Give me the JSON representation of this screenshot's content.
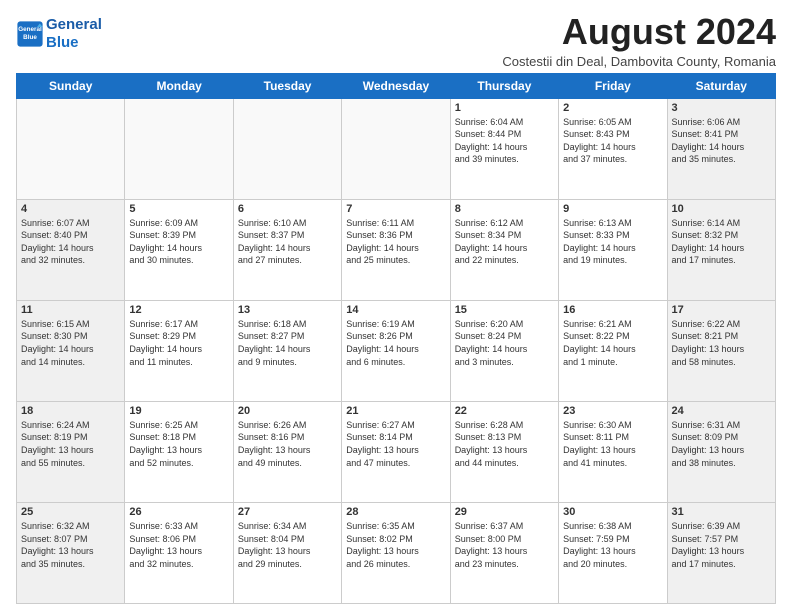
{
  "logo": {
    "line1": "General",
    "line2": "Blue"
  },
  "title": "August 2024",
  "subtitle": "Costestii din Deal, Dambovita County, Romania",
  "days_header": [
    "Sunday",
    "Monday",
    "Tuesday",
    "Wednesday",
    "Thursday",
    "Friday",
    "Saturday"
  ],
  "weeks": [
    [
      {
        "day": "",
        "info": ""
      },
      {
        "day": "",
        "info": ""
      },
      {
        "day": "",
        "info": ""
      },
      {
        "day": "",
        "info": ""
      },
      {
        "day": "1",
        "info": "Sunrise: 6:04 AM\nSunset: 8:44 PM\nDaylight: 14 hours\nand 39 minutes."
      },
      {
        "day": "2",
        "info": "Sunrise: 6:05 AM\nSunset: 8:43 PM\nDaylight: 14 hours\nand 37 minutes."
      },
      {
        "day": "3",
        "info": "Sunrise: 6:06 AM\nSunset: 8:41 PM\nDaylight: 14 hours\nand 35 minutes."
      }
    ],
    [
      {
        "day": "4",
        "info": "Sunrise: 6:07 AM\nSunset: 8:40 PM\nDaylight: 14 hours\nand 32 minutes."
      },
      {
        "day": "5",
        "info": "Sunrise: 6:09 AM\nSunset: 8:39 PM\nDaylight: 14 hours\nand 30 minutes."
      },
      {
        "day": "6",
        "info": "Sunrise: 6:10 AM\nSunset: 8:37 PM\nDaylight: 14 hours\nand 27 minutes."
      },
      {
        "day": "7",
        "info": "Sunrise: 6:11 AM\nSunset: 8:36 PM\nDaylight: 14 hours\nand 25 minutes."
      },
      {
        "day": "8",
        "info": "Sunrise: 6:12 AM\nSunset: 8:34 PM\nDaylight: 14 hours\nand 22 minutes."
      },
      {
        "day": "9",
        "info": "Sunrise: 6:13 AM\nSunset: 8:33 PM\nDaylight: 14 hours\nand 19 minutes."
      },
      {
        "day": "10",
        "info": "Sunrise: 6:14 AM\nSunset: 8:32 PM\nDaylight: 14 hours\nand 17 minutes."
      }
    ],
    [
      {
        "day": "11",
        "info": "Sunrise: 6:15 AM\nSunset: 8:30 PM\nDaylight: 14 hours\nand 14 minutes."
      },
      {
        "day": "12",
        "info": "Sunrise: 6:17 AM\nSunset: 8:29 PM\nDaylight: 14 hours\nand 11 minutes."
      },
      {
        "day": "13",
        "info": "Sunrise: 6:18 AM\nSunset: 8:27 PM\nDaylight: 14 hours\nand 9 minutes."
      },
      {
        "day": "14",
        "info": "Sunrise: 6:19 AM\nSunset: 8:26 PM\nDaylight: 14 hours\nand 6 minutes."
      },
      {
        "day": "15",
        "info": "Sunrise: 6:20 AM\nSunset: 8:24 PM\nDaylight: 14 hours\nand 3 minutes."
      },
      {
        "day": "16",
        "info": "Sunrise: 6:21 AM\nSunset: 8:22 PM\nDaylight: 14 hours\nand 1 minute."
      },
      {
        "day": "17",
        "info": "Sunrise: 6:22 AM\nSunset: 8:21 PM\nDaylight: 13 hours\nand 58 minutes."
      }
    ],
    [
      {
        "day": "18",
        "info": "Sunrise: 6:24 AM\nSunset: 8:19 PM\nDaylight: 13 hours\nand 55 minutes."
      },
      {
        "day": "19",
        "info": "Sunrise: 6:25 AM\nSunset: 8:18 PM\nDaylight: 13 hours\nand 52 minutes."
      },
      {
        "day": "20",
        "info": "Sunrise: 6:26 AM\nSunset: 8:16 PM\nDaylight: 13 hours\nand 49 minutes."
      },
      {
        "day": "21",
        "info": "Sunrise: 6:27 AM\nSunset: 8:14 PM\nDaylight: 13 hours\nand 47 minutes."
      },
      {
        "day": "22",
        "info": "Sunrise: 6:28 AM\nSunset: 8:13 PM\nDaylight: 13 hours\nand 44 minutes."
      },
      {
        "day": "23",
        "info": "Sunrise: 6:30 AM\nSunset: 8:11 PM\nDaylight: 13 hours\nand 41 minutes."
      },
      {
        "day": "24",
        "info": "Sunrise: 6:31 AM\nSunset: 8:09 PM\nDaylight: 13 hours\nand 38 minutes."
      }
    ],
    [
      {
        "day": "25",
        "info": "Sunrise: 6:32 AM\nSunset: 8:07 PM\nDaylight: 13 hours\nand 35 minutes."
      },
      {
        "day": "26",
        "info": "Sunrise: 6:33 AM\nSunset: 8:06 PM\nDaylight: 13 hours\nand 32 minutes."
      },
      {
        "day": "27",
        "info": "Sunrise: 6:34 AM\nSunset: 8:04 PM\nDaylight: 13 hours\nand 29 minutes."
      },
      {
        "day": "28",
        "info": "Sunrise: 6:35 AM\nSunset: 8:02 PM\nDaylight: 13 hours\nand 26 minutes."
      },
      {
        "day": "29",
        "info": "Sunrise: 6:37 AM\nSunset: 8:00 PM\nDaylight: 13 hours\nand 23 minutes."
      },
      {
        "day": "30",
        "info": "Sunrise: 6:38 AM\nSunset: 7:59 PM\nDaylight: 13 hours\nand 20 minutes."
      },
      {
        "day": "31",
        "info": "Sunrise: 6:39 AM\nSunset: 7:57 PM\nDaylight: 13 hours\nand 17 minutes."
      }
    ]
  ]
}
